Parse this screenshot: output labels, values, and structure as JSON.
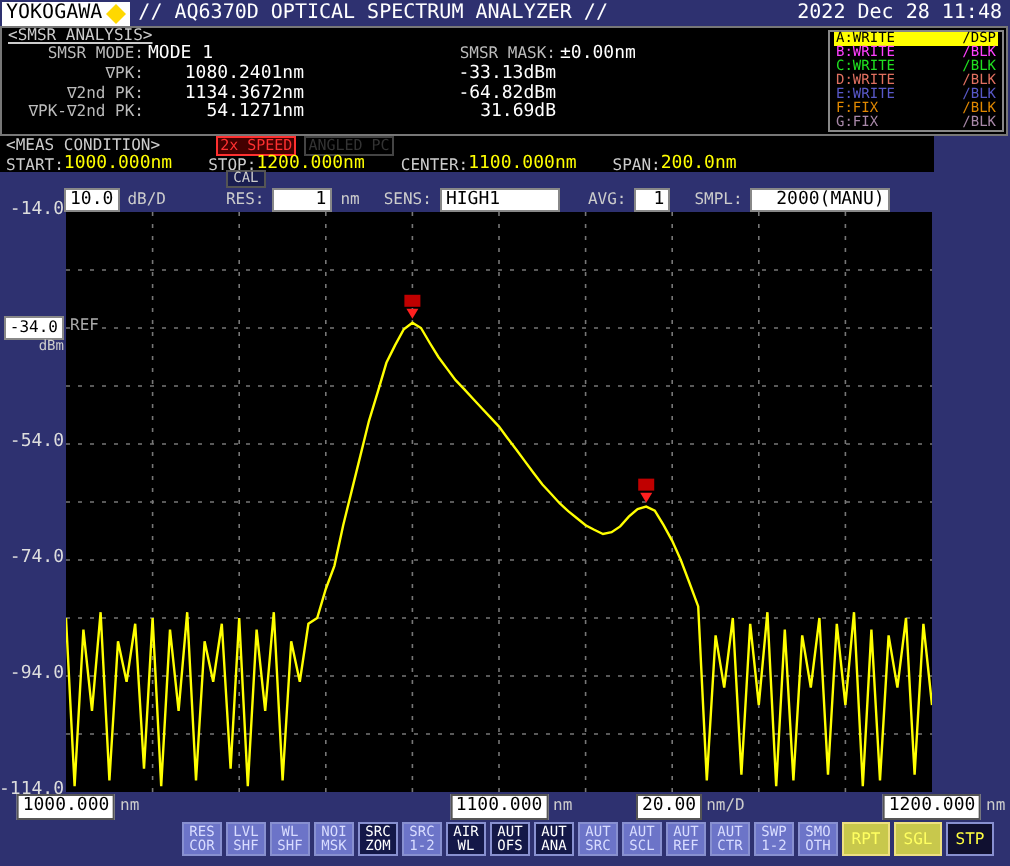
{
  "header": {
    "brand": "YOKOGAWA",
    "title": "// AQ6370D OPTICAL SPECTRUM ANALYZER //",
    "datetime": "2022 Dec 28 11:48"
  },
  "smsr": {
    "title": "<SMSR ANALYSIS>",
    "mode_label": "SMSR MODE:",
    "mode": "MODE 1",
    "mask_label": "SMSR MASK:",
    "mask": "±0.00nm",
    "rows": [
      {
        "label": "∇PK:",
        "wavelength": "1080.2401nm",
        "power": "-33.13dBm"
      },
      {
        "label": "∇2nd PK:",
        "wavelength": "1134.3672nm",
        "power": "-64.82dBm"
      },
      {
        "label": "∇PK-∇2nd PK:",
        "wavelength": "54.1271nm",
        "power": "31.69dB"
      }
    ]
  },
  "traces": [
    {
      "name": "A:WRITE",
      "mode": "/DSP",
      "color": "#ffff00",
      "selected": true
    },
    {
      "name": "B:WRITE",
      "mode": "/BLK",
      "color": "#ff40ff",
      "selected": false
    },
    {
      "name": "C:WRITE",
      "mode": "/BLK",
      "color": "#20e020",
      "selected": false
    },
    {
      "name": "D:WRITE",
      "mode": "/BLK",
      "color": "#e07060",
      "selected": false
    },
    {
      "name": "E:WRITE",
      "mode": "/BLK",
      "color": "#5858c8",
      "selected": false
    },
    {
      "name": "F:FIX",
      "mode": "/BLK",
      "color": "#e08800",
      "selected": false
    },
    {
      "name": "G:FIX",
      "mode": "/BLK",
      "color": "#a888a8",
      "selected": false
    }
  ],
  "meas": {
    "title": "<MEAS CONDITION>",
    "tags": [
      {
        "label": "2x SPEED",
        "on": true
      },
      {
        "label": "ANGLED PC",
        "on": false
      }
    ],
    "fields": [
      {
        "label": "START:",
        "value": "1000.000nm"
      },
      {
        "label": "STOP:",
        "value": "1200.000nm"
      },
      {
        "label": "CENTER:",
        "value": "1100.000nm"
      },
      {
        "label": "SPAN:",
        "value": "200.0nm"
      }
    ]
  },
  "settings": {
    "scale": "10.0",
    "scale_unit": "dB/D",
    "cal": "CAL",
    "res_label": "RES:",
    "res": "1",
    "res_unit": "nm",
    "sens_label": "SENS:",
    "sens": "HIGH1",
    "avg_label": "AVG:",
    "avg": "1",
    "smpl_label": "SMPL:",
    "smpl": "2000(MANU)"
  },
  "chart_data": {
    "type": "line",
    "xlim": [
      1000,
      1200
    ],
    "ylim": [
      -114,
      -14
    ],
    "ylabel": "dBm",
    "xticks": [
      {
        "value": 1000,
        "label": "1000.000"
      },
      {
        "value": 1100,
        "label": "1100.000"
      },
      {
        "value": 1200,
        "label": "1200.000"
      }
    ],
    "yticks": [
      {
        "value": -14,
        "label": "-14.0"
      },
      {
        "value": -34,
        "label": "-34.0"
      },
      {
        "value": -54,
        "label": "-54.0"
      },
      {
        "value": -74,
        "label": "-74.0"
      },
      {
        "value": -94,
        "label": "-94.0"
      },
      {
        "value": -114,
        "label": "-114.0"
      }
    ],
    "annotations": [
      "REF"
    ],
    "x": [
      1000,
      1002,
      1004,
      1006,
      1008,
      1010,
      1012,
      1014,
      1016,
      1018,
      1020,
      1022,
      1024,
      1026,
      1028,
      1030,
      1032,
      1034,
      1036,
      1038,
      1040,
      1042,
      1044,
      1046,
      1048,
      1050,
      1052,
      1054,
      1056,
      1058,
      1060,
      1062,
      1064,
      1066,
      1068,
      1070,
      1072,
      1074,
      1076,
      1078,
      1080,
      1082,
      1084,
      1086,
      1088,
      1090,
      1092,
      1094,
      1096,
      1098,
      1100,
      1102,
      1104,
      1106,
      1108,
      1110,
      1112,
      1114,
      1116,
      1118,
      1120,
      1122,
      1124,
      1126,
      1128,
      1130,
      1132,
      1134,
      1136,
      1138,
      1140,
      1142,
      1144,
      1146,
      1148,
      1150,
      1152,
      1154,
      1156,
      1158,
      1160,
      1162,
      1164,
      1166,
      1168,
      1170,
      1172,
      1174,
      1176,
      1178,
      1180,
      1182,
      1184,
      1186,
      1188,
      1190,
      1192,
      1194,
      1196,
      1198,
      1200
    ],
    "series": [
      {
        "color": "#ffff00",
        "values": [
          -84,
          -113,
          -86,
          -100,
          -83,
          -112,
          -88,
          -95,
          -85,
          -110,
          -84,
          -113,
          -86,
          -100,
          -83,
          -112,
          -88,
          -95,
          -85,
          -110,
          -84,
          -113,
          -86,
          -100,
          -83,
          -112,
          -88,
          -95,
          -85,
          -84,
          -79,
          -75,
          -68,
          -62,
          -56,
          -50,
          -45,
          -40,
          -37,
          -34.2,
          -33.1,
          -34,
          -36.6,
          -39,
          -41,
          -43,
          -44.6,
          -46.2,
          -47.8,
          -49.4,
          -51,
          -53,
          -55,
          -57,
          -59,
          -61,
          -62.6,
          -64.2,
          -65.6,
          -66.8,
          -68,
          -68.8,
          -69.5,
          -69.2,
          -68.2,
          -66.5,
          -65.2,
          -64.8,
          -65.5,
          -68,
          -70.7,
          -74,
          -78,
          -82,
          -112,
          -87,
          -96,
          -84,
          -111,
          -85,
          -99,
          -83,
          -113,
          -86,
          -112,
          -87,
          -96,
          -84,
          -111,
          -85,
          -99,
          -83,
          -113,
          -86,
          -112,
          -87,
          -96,
          -84,
          -111,
          -85,
          -99
        ]
      }
    ],
    "grid": true
  },
  "x_tick_units": [
    "nm",
    "nm",
    "nm"
  ],
  "x_division": {
    "value": "20.00",
    "unit": "nm/D"
  },
  "softkeys": [
    {
      "label": "RES\nCOR",
      "kind": "normal"
    },
    {
      "label": "LVL\nSHF",
      "kind": "normal"
    },
    {
      "label": "WL\nSHF",
      "kind": "normal"
    },
    {
      "label": "NOI\nMSK",
      "kind": "normal"
    },
    {
      "label": "SRC\nZOM",
      "kind": "dark"
    },
    {
      "label": "SRC\n1-2",
      "kind": "normal"
    },
    {
      "label": "AIR\nWL",
      "kind": "dark"
    },
    {
      "label": "AUT\nOFS",
      "kind": "dark"
    },
    {
      "label": "AUT\nANA",
      "kind": "dark"
    },
    {
      "label": "AUT\nSRC",
      "kind": "normal"
    },
    {
      "label": "AUT\nSCL",
      "kind": "normal"
    },
    {
      "label": "AUT\nREF",
      "kind": "normal"
    },
    {
      "label": "AUT\nCTR",
      "kind": "normal"
    },
    {
      "label": "SWP\n1-2",
      "kind": "normal"
    },
    {
      "label": "SMO\nOTH",
      "kind": "normal"
    },
    {
      "label": "RPT",
      "kind": "run"
    },
    {
      "label": "SGL",
      "kind": "run"
    },
    {
      "label": "STP",
      "kind": "stop"
    }
  ]
}
